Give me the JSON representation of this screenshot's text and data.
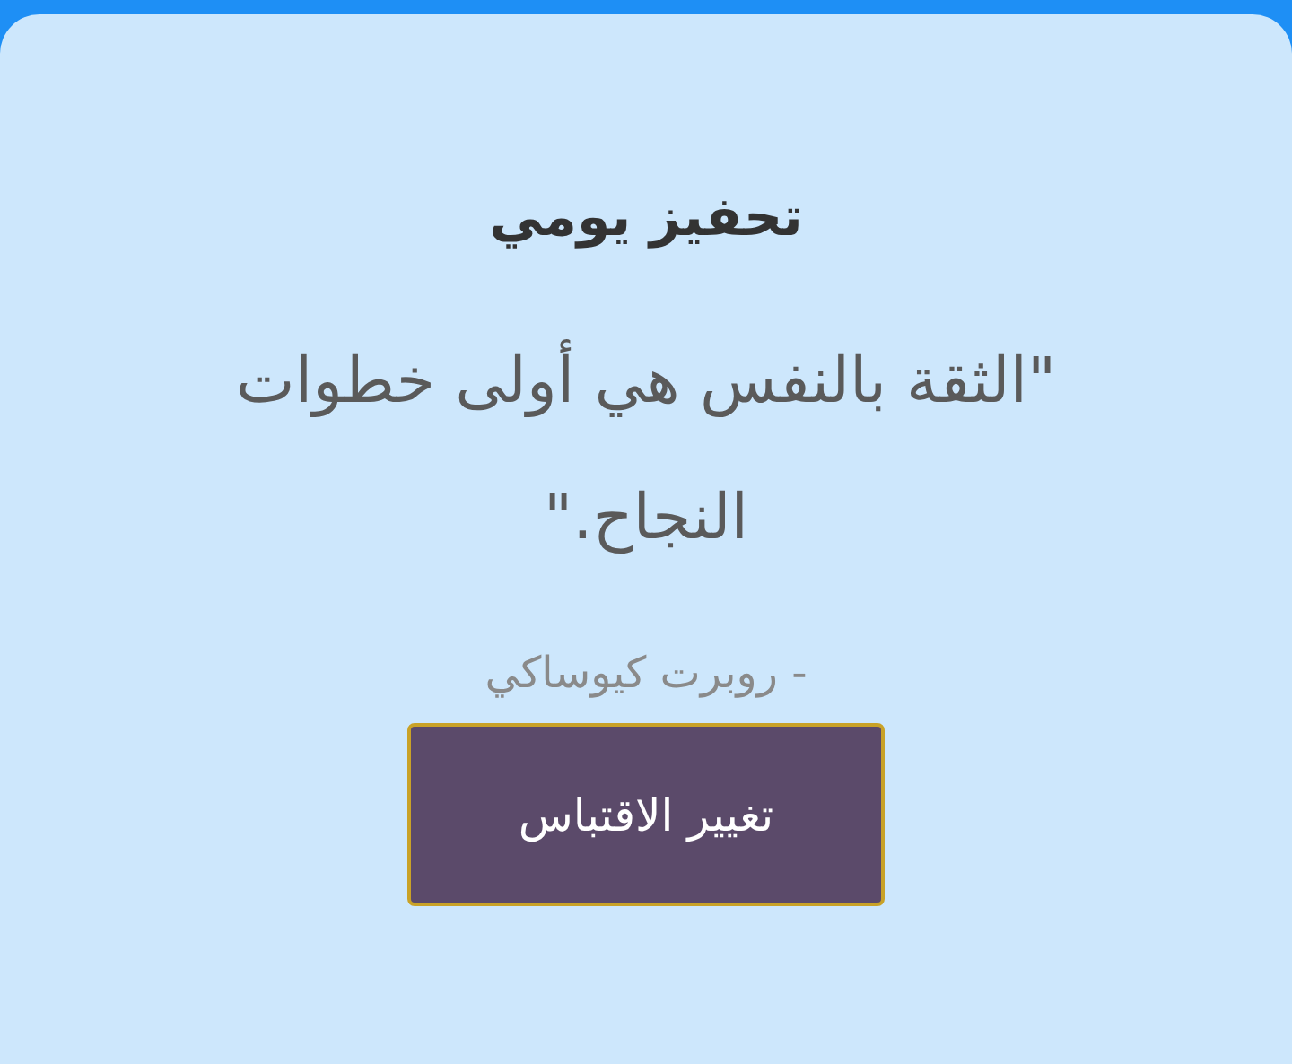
{
  "title": "تحفيز يومي",
  "quote": "\"الثقة بالنفس هي أولى خطوات النجاح.\"",
  "author": "- روبرت كيوساكي",
  "button": "تغيير الاقتباس"
}
